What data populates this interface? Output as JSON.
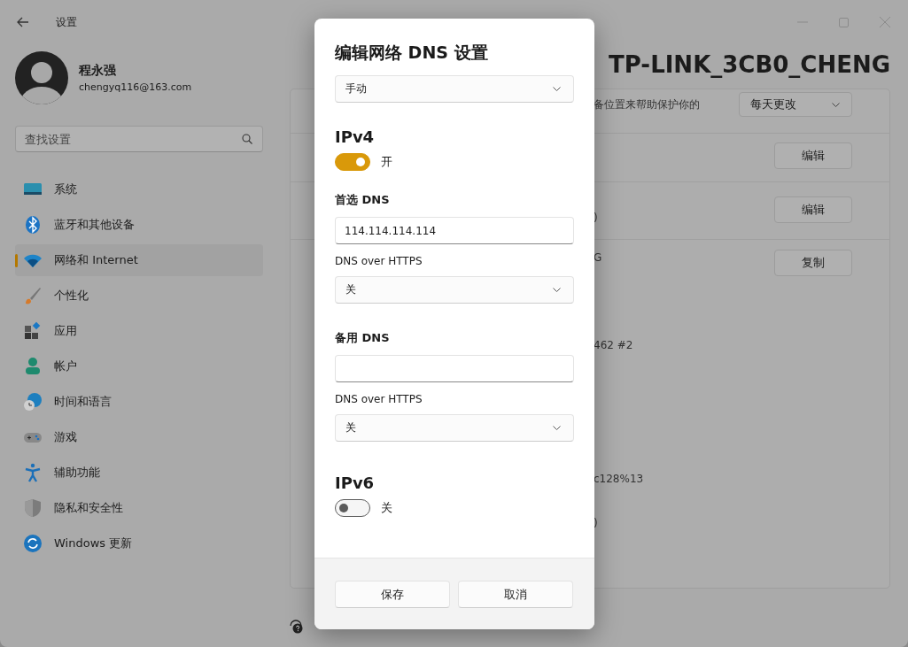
{
  "window": {
    "title": "设置"
  },
  "user": {
    "name": "程永强",
    "email": "chengyq116@163.com"
  },
  "search": {
    "placeholder": "查找设置"
  },
  "sidebar": {
    "items": [
      {
        "label": "系统",
        "kind": "system",
        "selected": false
      },
      {
        "label": "蓝牙和其他设备",
        "kind": "bluetooth",
        "selected": false
      },
      {
        "label": "网络和 Internet",
        "kind": "wifi",
        "selected": true
      },
      {
        "label": "个性化",
        "kind": "brush",
        "selected": false
      },
      {
        "label": "应用",
        "kind": "apps",
        "selected": false
      },
      {
        "label": "帐户",
        "kind": "person",
        "selected": false
      },
      {
        "label": "时间和语言",
        "kind": "globe",
        "selected": false
      },
      {
        "label": "游戏",
        "kind": "gamepad",
        "selected": false
      },
      {
        "label": "辅助功能",
        "kind": "accessibility",
        "selected": false
      },
      {
        "label": "隐私和安全性",
        "kind": "shield",
        "selected": false
      },
      {
        "label": "Windows 更新",
        "kind": "sync",
        "selected": false
      }
    ]
  },
  "page": {
    "title": "TP-LINK_3CB0_CHENG",
    "rows": [
      {
        "text": "备位置来帮助保护你的",
        "control": {
          "kind": "dropdown",
          "label": "每天更改"
        }
      },
      {
        "control": {
          "kind": "button",
          "label": "编辑"
        }
      },
      {
        "text": ")",
        "control": {
          "kind": "button",
          "label": "编辑"
        }
      },
      {
        "text": "G",
        "control": {
          "kind": "button",
          "label": "复制"
        }
      },
      {
        "text": "462 #2"
      },
      {
        "text": "c128%13"
      },
      {
        "text": ")"
      }
    ]
  },
  "dialog": {
    "title": "编辑网络 DNS 设置",
    "mode": "手动",
    "sections": [
      {
        "heading": "IPv4",
        "on": true,
        "state_label": "开",
        "preferred_label": "首选 DNS",
        "preferred_value": "114.114.114.114",
        "preferred_doh_label": "DNS over HTTPS",
        "preferred_doh": "关",
        "alternate_label": "备用 DNS",
        "alternate_doh_label": "DNS over HTTPS",
        "alternate_doh": "关"
      },
      {
        "heading": "IPv6",
        "on": false,
        "state_label": "关"
      }
    ],
    "buttons": [
      "保存",
      "取消"
    ]
  }
}
